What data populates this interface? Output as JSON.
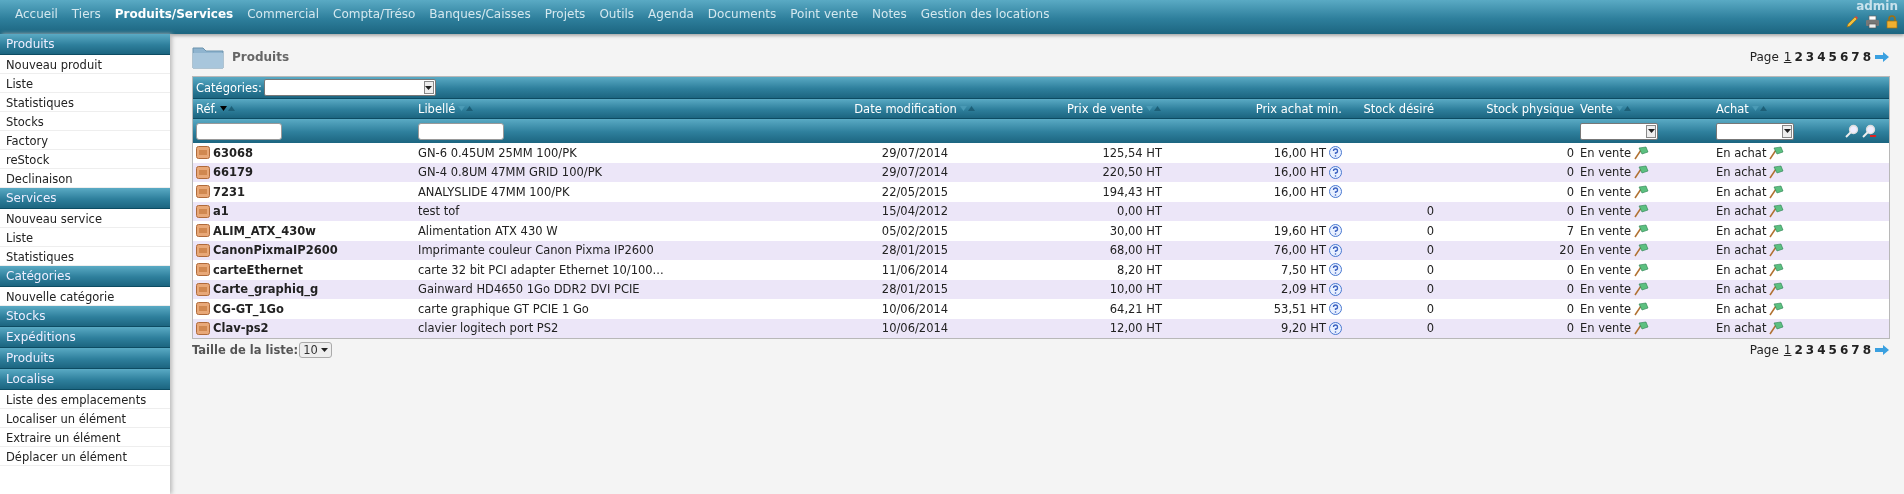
{
  "top_menu": [
    {
      "label": "Accueil",
      "selected": false
    },
    {
      "label": "Tiers",
      "selected": false
    },
    {
      "label": "Produits/Services",
      "selected": true
    },
    {
      "label": "Commercial",
      "selected": false
    },
    {
      "label": "Compta/Tréso",
      "selected": false
    },
    {
      "label": "Banques/Caisses",
      "selected": false
    },
    {
      "label": "Projets",
      "selected": false
    },
    {
      "label": "Outils",
      "selected": false
    },
    {
      "label": "Agenda",
      "selected": false
    },
    {
      "label": "Documents",
      "selected": false
    },
    {
      "label": "Point vente",
      "selected": false
    },
    {
      "label": "Notes",
      "selected": false
    },
    {
      "label": "Gestion des locations",
      "selected": false
    }
  ],
  "user": "admin",
  "sidebar": [
    {
      "title": "Produits",
      "items": [
        "Nouveau produit",
        "Liste",
        "Statistiques",
        "Stocks",
        "Factory",
        "reStock",
        "Declinaison"
      ]
    },
    {
      "title": "Services",
      "items": [
        "Nouveau service",
        "Liste",
        "Statistiques"
      ]
    },
    {
      "title": "Catégories",
      "items": [
        "Nouvelle catégorie"
      ]
    },
    {
      "title": "Stocks"
    },
    {
      "title": "Expéditions"
    },
    {
      "title": "Produits"
    },
    {
      "title": "Localise",
      "items": [
        "Liste des emplacements",
        "Localiser un élément",
        "Extraire un élément",
        "Déplacer un élément"
      ]
    }
  ],
  "page_title": "Produits",
  "pagination_top": {
    "label": "Page",
    "pages": [
      {
        "label": "1",
        "selected": true
      },
      {
        "label": "2",
        "selected": false
      },
      {
        "label": "3",
        "selected": false
      },
      {
        "label": "4",
        "selected": false
      },
      {
        "label": "5",
        "selected": false
      },
      {
        "label": "6",
        "selected": false
      },
      {
        "label": "7",
        "selected": false
      },
      {
        "label": "8",
        "selected": false
      }
    ]
  },
  "categories_label": "Catégories:",
  "columns": [
    {
      "label": "Réf.",
      "sortable": true,
      "sorted": true,
      "kind": "text"
    },
    {
      "label": "Libellé",
      "sortable": true,
      "sorted": false,
      "kind": "text"
    },
    {
      "label": "Date modification",
      "sortable": true,
      "sorted": false,
      "kind": "plain"
    },
    {
      "label": "Prix de vente",
      "sortable": true,
      "sorted": false,
      "kind": "plain"
    },
    {
      "label": "Prix achat min.",
      "sortable": false,
      "kind": "plain"
    },
    {
      "label": "Stock désiré",
      "sortable": false,
      "kind": "plain"
    },
    {
      "label": "Stock physique",
      "sortable": false,
      "kind": "plain"
    },
    {
      "label": "Vente",
      "sortable": true,
      "sorted": false,
      "kind": "select"
    },
    {
      "label": "Achat",
      "sortable": true,
      "sorted": false,
      "kind": "select"
    }
  ],
  "rows": [
    {
      "ref": "63068",
      "label": "GN-6 0.45UM 25MM 100/PK",
      "date": "29/07/2014",
      "price": "125,54 HT",
      "buy_price": "16,00 HT",
      "stock": "0",
      "sale": "En vente",
      "purchase": "En achat"
    },
    {
      "ref": "66179",
      "label": "GN-4 0.8UM 47MM GRID 100/PK",
      "date": "29/07/2014",
      "price": "220,50 HT",
      "buy_price": "16,00 HT",
      "stock": "0",
      "sale": "En vente",
      "purchase": "En achat"
    },
    {
      "ref": "7231",
      "label": "ANALYSLIDE 47MM 100/PK",
      "date": "22/05/2015",
      "price": "194,43 HT",
      "buy_price": "16,00 HT",
      "stock": "0",
      "sale": "En vente",
      "purchase": "En achat"
    },
    {
      "ref": "a1",
      "label": "test tof",
      "date": "15/04/2012",
      "price": "0,00 HT",
      "stock_desired": "0",
      "stock": "0",
      "sale": "En vente",
      "purchase": "En achat"
    },
    {
      "ref": "ALIM_ATX_430w",
      "label": "Alimentation ATX 430 W",
      "date": "05/02/2015",
      "price": "30,00 HT",
      "buy_price": "19,60 HT",
      "stock_desired": "0",
      "stock": "7",
      "sale": "En vente",
      "purchase": "En achat"
    },
    {
      "ref": "CanonPixmaIP2600",
      "label": "Imprimante couleur Canon Pixma IP2600",
      "date": "28/01/2015",
      "price": "68,00 HT",
      "buy_price": "76,00 HT",
      "stock_desired": "0",
      "stock": "20",
      "sale": "En vente",
      "purchase": "En achat"
    },
    {
      "ref": "carteEthernet",
      "label": "carte 32 bit PCI adapter Ethernet 10/100...",
      "date": "11/06/2014",
      "price": "8,20 HT",
      "buy_price": "7,50 HT",
      "stock_desired": "0",
      "stock": "0",
      "sale": "En vente",
      "purchase": "En achat"
    },
    {
      "ref": "Carte_graphiq_g",
      "label": "Gainward HD4650 1Go DDR2 DVI PCIE",
      "date": "28/01/2015",
      "price": "10,00 HT",
      "buy_price": "2,09 HT",
      "stock_desired": "0",
      "stock": "0",
      "sale": "En vente",
      "purchase": "En achat"
    },
    {
      "ref": "CG-GT_1Go",
      "label": "carte graphique GT PCIE 1 Go",
      "date": "10/06/2014",
      "price": "64,21 HT",
      "buy_price": "53,51 HT",
      "stock_desired": "0",
      "stock": "0",
      "sale": "En vente",
      "purchase": "En achat"
    },
    {
      "ref": "Clav-ps2",
      "label": "clavier logitech port PS2",
      "date": "10/06/2014",
      "price": "12,00 HT",
      "buy_price": "9,20 HT",
      "stock_desired": "0",
      "stock": "0",
      "sale": "En vente",
      "purchase": "En achat"
    }
  ],
  "list_size_label": "Taille de la liste:",
  "list_size": "10",
  "pagination_bottom": {
    "label": "Page",
    "pages": [
      {
        "label": "1",
        "selected": true
      },
      {
        "label": "2",
        "selected": false
      },
      {
        "label": "3",
        "selected": false
      },
      {
        "label": "4",
        "selected": false
      },
      {
        "label": "5",
        "selected": false
      },
      {
        "label": "6",
        "selected": false
      },
      {
        "label": "7",
        "selected": false
      },
      {
        "label": "8",
        "selected": false
      }
    ]
  }
}
